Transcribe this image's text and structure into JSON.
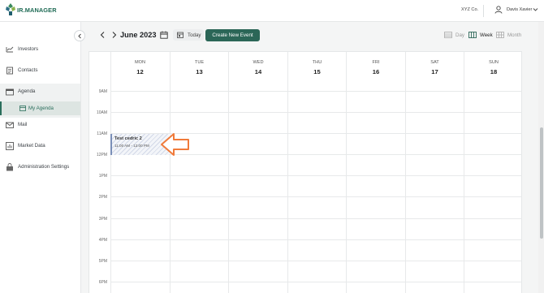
{
  "brand": {
    "name": "IR.MANAGER"
  },
  "header": {
    "company": "XYZ Co.",
    "user_name": "Davis Xavier"
  },
  "sidebar": {
    "items": [
      {
        "label": "Investors",
        "icon": "investors-icon"
      },
      {
        "label": "Contacts",
        "icon": "contacts-icon"
      },
      {
        "label": "Agenda",
        "icon": "agenda-icon"
      },
      {
        "label": "My Agenda",
        "icon": "calendar-icon",
        "active": true
      },
      {
        "label": "Mail",
        "icon": "mail-icon"
      },
      {
        "label": "Market Data",
        "icon": "market-data-icon"
      },
      {
        "label": "Administration Settings",
        "icon": "settings-icon"
      }
    ]
  },
  "toolbar": {
    "title": "June 2023",
    "today_label": "Today",
    "create_label": "Create New Event",
    "views": [
      "Day",
      "Week",
      "Month"
    ],
    "active_view": "Week"
  },
  "calendar": {
    "days": [
      {
        "name": "MON",
        "date": "12"
      },
      {
        "name": "TUE",
        "date": "13"
      },
      {
        "name": "WED",
        "date": "14"
      },
      {
        "name": "THU",
        "date": "15"
      },
      {
        "name": "FRI",
        "date": "16"
      },
      {
        "name": "SAT",
        "date": "17"
      },
      {
        "name": "SUN",
        "date": "18"
      }
    ],
    "hours": [
      "9AM",
      "10AM",
      "11AM",
      "12PM",
      "1PM",
      "2PM",
      "3PM",
      "4PM",
      "5PM",
      "6PM"
    ],
    "event": {
      "title": "Test cedric 2",
      "time": "11:00 AM - 12:00 PM",
      "day": "MON"
    }
  },
  "colors": {
    "accent": "#2b6657",
    "brand": "#1f6b55",
    "event_border": "#7a8fb8",
    "annotation": "#f07a3a"
  }
}
